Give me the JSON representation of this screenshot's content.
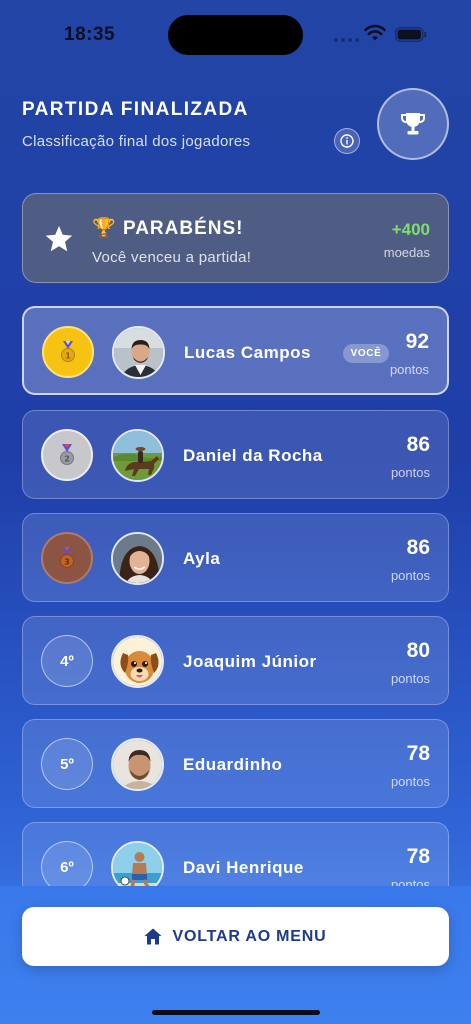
{
  "status_bar": {
    "time": "18:35"
  },
  "header": {
    "title": "PARTIDA FINALIZADA",
    "subtitle": "Classificação final dos jogadores"
  },
  "win_banner": {
    "emoji": "🏆",
    "title": "PARABÉNS!",
    "message": "Você venceu a partida!",
    "reward": "+400",
    "reward_unit": "moedas"
  },
  "colors": {
    "accent_green": "#7ee06a",
    "gold": "#f6c313",
    "silver": "#c8c8cc",
    "bronze": "#8c5442",
    "button_text": "#1e3a8a"
  },
  "ranking": {
    "players": [
      {
        "rank_label": "",
        "medal": "gold",
        "name": "Lucas Campos",
        "badge": "VOCÊ",
        "score": "92",
        "score_unit": "pontos"
      },
      {
        "rank_label": "",
        "medal": "silver",
        "name": "Daniel da Rocha",
        "score": "86",
        "score_unit": "pontos"
      },
      {
        "rank_label": "",
        "medal": "bronze",
        "name": "Ayla",
        "score": "86",
        "score_unit": "pontos"
      },
      {
        "rank_label": "4º",
        "name": "Joaquim Júnior",
        "score": "80",
        "score_unit": "pontos"
      },
      {
        "rank_label": "5º",
        "name": "Eduardinho",
        "score": "78",
        "score_unit": "pontos"
      },
      {
        "rank_label": "6º",
        "name": "Davi Henrique",
        "score": "78",
        "score_unit": "pontos"
      }
    ]
  },
  "actions": {
    "back_to_menu": "VOLTAR AO MENU"
  }
}
